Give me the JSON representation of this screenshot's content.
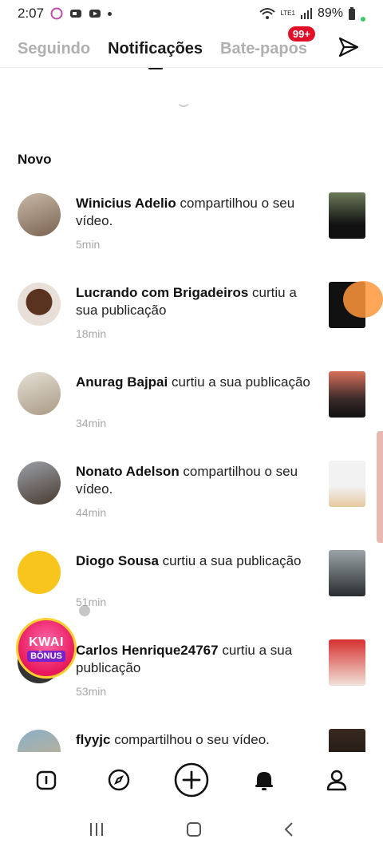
{
  "status_bar": {
    "time": "2:07",
    "battery": "89%",
    "network_label": "LTE1"
  },
  "tabs": [
    {
      "label": "Seguindo",
      "active": false
    },
    {
      "label": "Notificações",
      "active": true
    },
    {
      "label": "Bate-papos",
      "active": false,
      "badge": "99+"
    }
  ],
  "section_title": "Novo",
  "notifications": [
    {
      "name": "Winicius Adelio",
      "action": " compartilhou o seu vídeo.",
      "time": "5min"
    },
    {
      "name": "Lucrando com Brigadeiros",
      "action": " curtiu a sua publicação",
      "time": "18min"
    },
    {
      "name": "Anurag Bajpai",
      "action": " curtiu a sua publicação",
      "time": "34min"
    },
    {
      "name": "Nonato Adelson",
      "action": " compartilhou o seu vídeo.",
      "time": "44min"
    },
    {
      "name": "Diogo Sousa",
      "action": " curtiu a sua publicação",
      "time": "51min"
    },
    {
      "name": "Carlos Henrique24767",
      "action": " curtiu a sua publicação",
      "time": "53min"
    },
    {
      "name": "flyyjc",
      "action": " compartilhou o seu vídeo.",
      "time": ""
    }
  ],
  "kwai_badge": {
    "line1": "KWAI",
    "line2": "BÔNUS"
  },
  "colors": {
    "badge": "#e0102a",
    "accent": "#1a1a1a",
    "muted": "#b0b0b0"
  }
}
